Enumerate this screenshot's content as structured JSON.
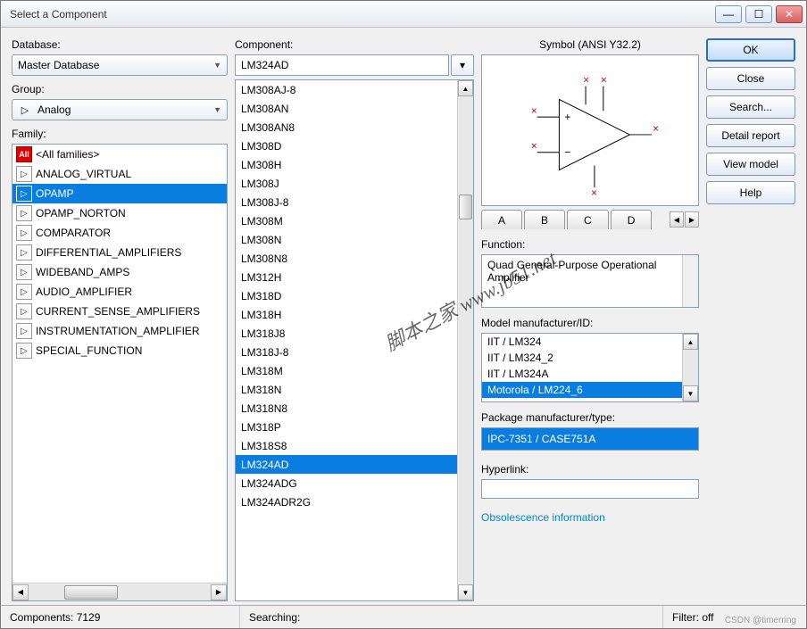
{
  "title": "Select a Component",
  "database_label": "Database:",
  "database_value": "Master Database",
  "group_label": "Group:",
  "group_value": "Analog",
  "family_label": "Family:",
  "families": [
    {
      "icon": "all",
      "label": "<All families>"
    },
    {
      "icon": "av",
      "label": "ANALOG_VIRTUAL"
    },
    {
      "icon": "op",
      "label": "OPAMP",
      "selected": true
    },
    {
      "icon": "op",
      "label": "OPAMP_NORTON"
    },
    {
      "icon": "cmp",
      "label": "COMPARATOR"
    },
    {
      "icon": "da",
      "label": "DIFFERENTIAL_AMPLIFIERS"
    },
    {
      "icon": "wb",
      "label": "WIDEBAND_AMPS"
    },
    {
      "icon": "aa",
      "label": "AUDIO_AMPLIFIER"
    },
    {
      "icon": "cs",
      "label": "CURRENT_SENSE_AMPLIFIERS"
    },
    {
      "icon": "ia",
      "label": "INSTRUMENTATION_AMPLIFIER"
    },
    {
      "icon": "sf",
      "label": "SPECIAL_FUNCTION"
    }
  ],
  "component_label": "Component:",
  "component_value": "LM324AD",
  "components": [
    "LM308AJ-8",
    "LM308AN",
    "LM308AN8",
    "LM308D",
    "LM308H",
    "LM308J",
    "LM308J-8",
    "LM308M",
    "LM308N",
    "LM308N8",
    "LM312H",
    "LM318D",
    "LM318H",
    "LM318J8",
    "LM318J-8",
    "LM318M",
    "LM318N",
    "LM318N8",
    "LM318P",
    "LM318S8",
    "LM324AD",
    "LM324ADG",
    "LM324ADR2G"
  ],
  "component_selected": "LM324AD",
  "symbol_label": "Symbol (ANSI Y32.2)",
  "tabs": [
    "A",
    "B",
    "C",
    "D"
  ],
  "function_label": "Function:",
  "function_text": "Quad General-Purpose Operational Amplifier",
  "model_label": "Model manufacturer/ID:",
  "models": [
    "IIT / LM324",
    "IIT / LM324_2",
    "IIT / LM324A",
    "Motorola / LM224_6"
  ],
  "model_selected": "Motorola / LM224_6",
  "package_label": "Package manufacturer/type:",
  "package_value": "IPC-7351 / CASE751A",
  "hyperlink_label": "Hyperlink:",
  "obsolescence": "Obsolescence information",
  "buttons": {
    "ok": "OK",
    "close": "Close",
    "search": "Search...",
    "detail": "Detail report",
    "view": "View model",
    "help": "Help"
  },
  "status": {
    "components": "Components: 7129",
    "searching": "Searching:",
    "filter": "Filter: off"
  },
  "watermark1": "脚本之家 www.jb51.net",
  "watermark2": "CSDN @timerring"
}
